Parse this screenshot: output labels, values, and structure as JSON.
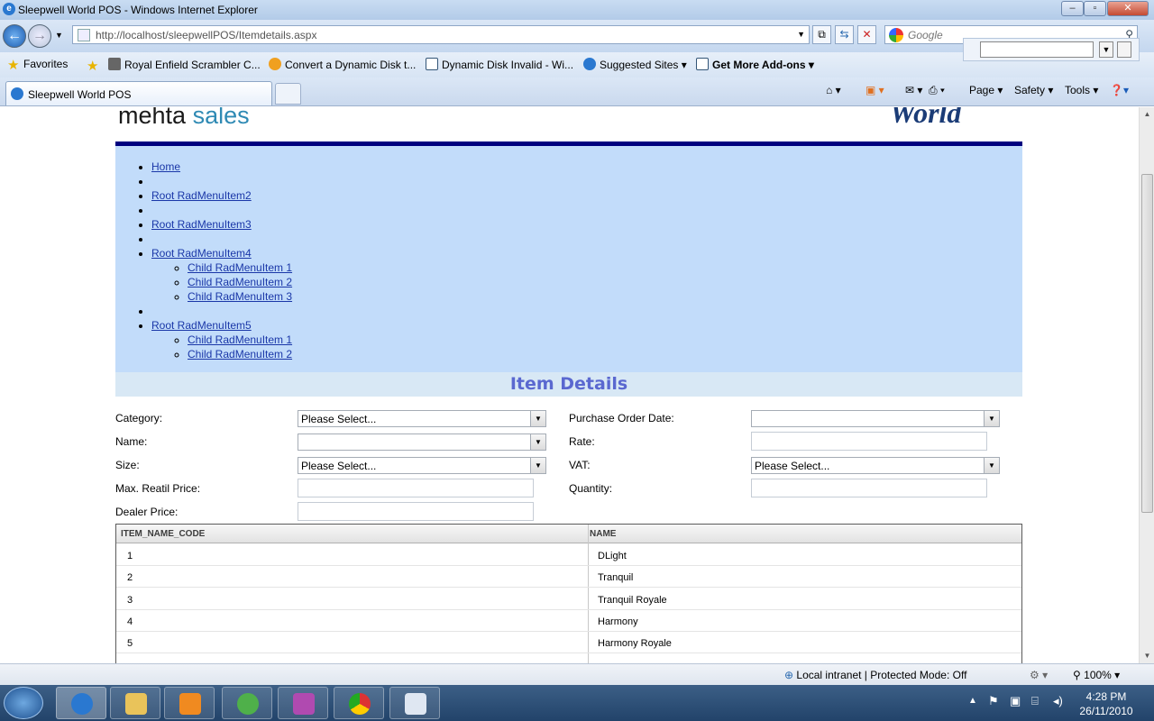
{
  "window": {
    "title": "Sleepwell World POS - Windows Internet Explorer"
  },
  "nav": {
    "url": "http://localhost/sleepwellPOS/Itemdetails.aspx",
    "search_placeholder": "Google"
  },
  "favorites": {
    "label": "Favorites",
    "items": [
      "Royal Enfield Scrambler C...",
      "Convert a Dynamic Disk t...",
      "Dynamic Disk Invalid - Wi...",
      "Suggested Sites",
      "Get More Add-ons"
    ]
  },
  "tab": {
    "title": "Sleepwell World POS"
  },
  "commands": {
    "page": "Page",
    "safety": "Safety",
    "tools": "Tools"
  },
  "header": {
    "logo_mehta": "mehta",
    "logo_sales": "sales",
    "logo_world": "World"
  },
  "menu": {
    "home": "Home",
    "root2": "Root RadMenuItem2",
    "root3": "Root RadMenuItem3",
    "root4": "Root RadMenuItem4",
    "root4_children": [
      "Child RadMenuItem 1",
      "Child RadMenuItem 2",
      "Child RadMenuItem 3"
    ],
    "root5": "Root RadMenuItem5",
    "root5_children": [
      "Child RadMenuItem 1",
      "Child RadMenuItem 2"
    ]
  },
  "form": {
    "heading": "Item Details",
    "category_label": "Category:",
    "category_value": "Please Select...",
    "name_label": "Name:",
    "name_value": "",
    "size_label": "Size:",
    "size_value": "Please Select...",
    "mrp_label": "Max. Reatil Price:",
    "dealer_label": "Dealer Price:",
    "po_date_label": "Purchase Order Date:",
    "po_date_value": "",
    "rate_label": "Rate:",
    "vat_label": "VAT:",
    "vat_value": "Please Select...",
    "quantity_label": "Quantity:"
  },
  "grid": {
    "columns": [
      "ITEM_NAME_CODE",
      "NAME"
    ],
    "rows": [
      [
        "1",
        "DLight"
      ],
      [
        "2",
        "Tranquil"
      ],
      [
        "3",
        "Tranquil Royale"
      ],
      [
        "4",
        "Harmony"
      ],
      [
        "5",
        "Harmony Royale"
      ]
    ]
  },
  "status": {
    "zone": "Local intranet | Protected Mode: Off",
    "zoom": "100%"
  },
  "clock": {
    "time": "4:28 PM",
    "date": "26/11/2010"
  }
}
